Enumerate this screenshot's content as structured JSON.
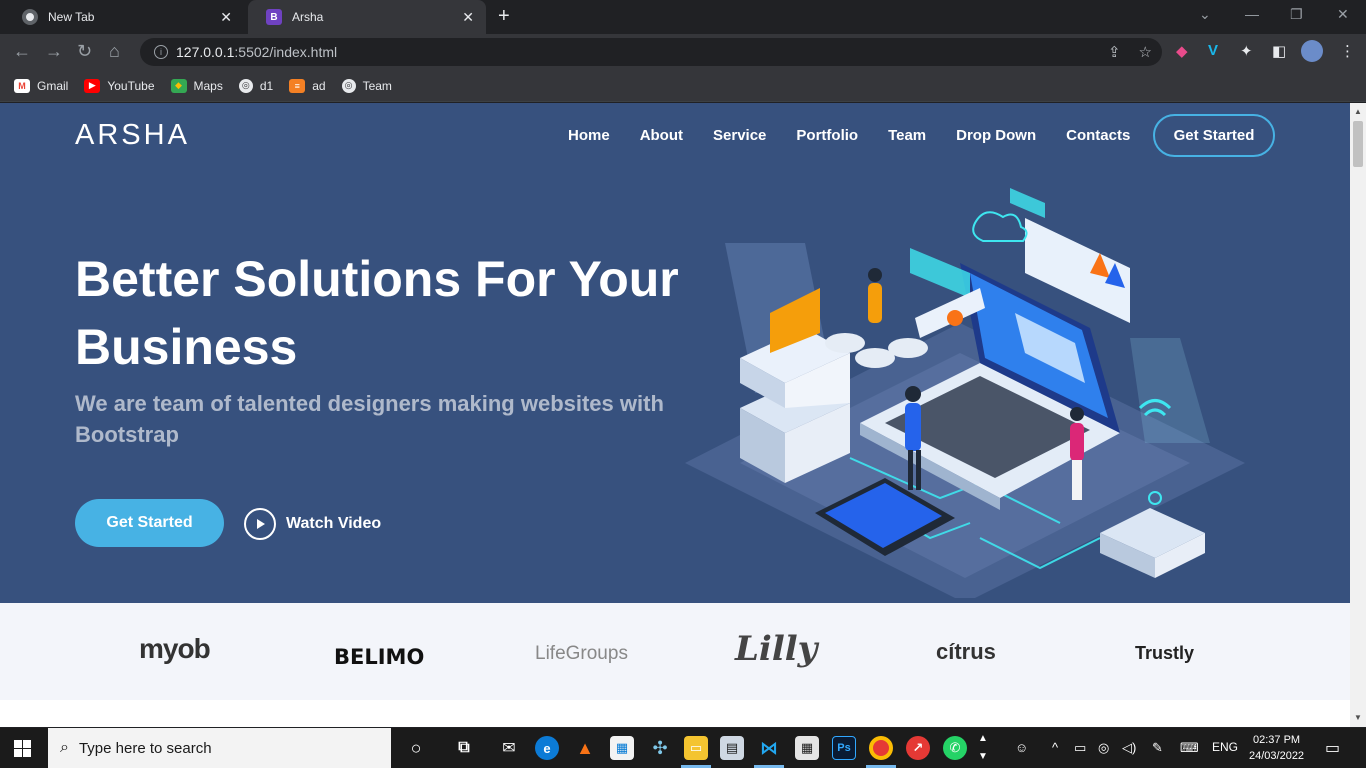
{
  "browser": {
    "tabs": [
      {
        "title": "New Tab",
        "active": false
      },
      {
        "title": "Arsha",
        "active": true,
        "favicon": "B"
      }
    ],
    "url_host": "127.0.0.1",
    "url_rest": ":5502/index.html",
    "bookmarks": [
      "Gmail",
      "YouTube",
      "Maps",
      "d1",
      "ad",
      "Team"
    ]
  },
  "page": {
    "logo": "ARSHA",
    "nav": [
      "Home",
      "About",
      "Service",
      "Portfolio",
      "Team",
      "Drop Down",
      "Contacts"
    ],
    "nav_cta": "Get Started",
    "hero_title": "Better Solutions For Your Business",
    "hero_subtitle": "We are team of talented designers making websites with Bootstrap",
    "cta_primary": "Get Started",
    "cta_video": "Watch Video",
    "clients": [
      "myob",
      "BELIMO",
      "LifeGroups",
      "Lilly",
      "cítrus",
      "Trustly"
    ],
    "colors": {
      "hero_bg": "#37517e",
      "accent": "#47b2e4",
      "clients_bg": "#f3f5fa"
    }
  },
  "taskbar": {
    "search_placeholder": "Type here to search",
    "language": "ENG",
    "time": "02:37 PM",
    "date": "24/03/2022"
  }
}
